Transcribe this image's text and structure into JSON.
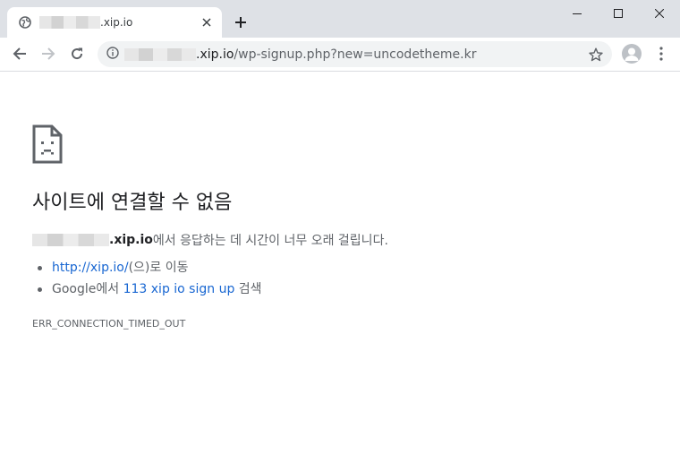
{
  "tab": {
    "title": ".xip.io",
    "close_icon": "close-icon",
    "new_tab_icon": "plus-icon"
  },
  "window_controls": [
    "minimize-icon",
    "maximize-icon",
    "close-icon"
  ],
  "toolbar": {
    "url_host_suffix": ".xip.io",
    "url_path": "/wp-signup.php?new=uncodetheme.kr"
  },
  "page": {
    "title": "사이트에 연결할 수 없음",
    "description": {
      "host": ".xip.io",
      "text": "에서 응답하는 데 시간이 너무 오래 걸립니다."
    },
    "suggestions": [
      {
        "link": "http://xip.io/",
        "text": "(으)로 이동"
      },
      {
        "prefix": "Google에서 ",
        "link": "113 xip io sign up",
        "text": " 검색"
      }
    ],
    "error_code": "ERR_CONNECTION_TIMED_OUT"
  },
  "colors": {
    "tabstrip": "#dee1e6",
    "omnibox": "#f1f3f4",
    "link": "#1967d2",
    "text": "#202124",
    "secondary_text": "#5f6368"
  }
}
